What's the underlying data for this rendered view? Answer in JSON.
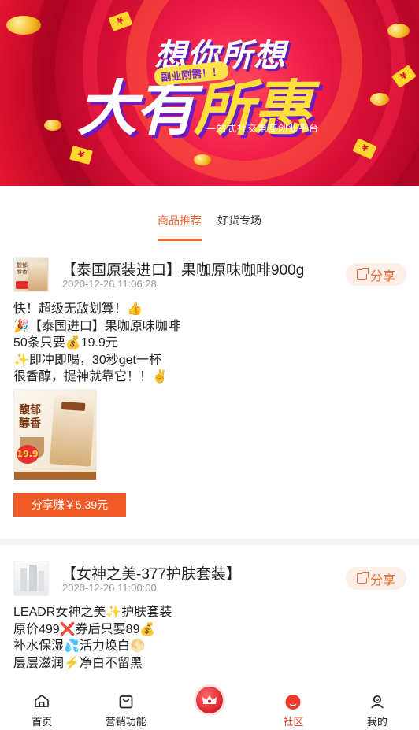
{
  "banner": {
    "line1": "想你所想",
    "tag": "副业刚需！！",
    "line2_a": "大有",
    "line2_b": "所惠",
    "subtitle": "—站式社交电商创业平台",
    "envelope_char": "¥"
  },
  "tabs": [
    {
      "label": "商品推荐",
      "active": true
    },
    {
      "label": "好货专场",
      "active": false
    }
  ],
  "posts": [
    {
      "title": "【泰国原装进口】果咖原味咖啡900g",
      "time": "2020-12-26 11:06:28",
      "share_label": "分享",
      "lines": [
        "快！超级无敌划算！👍",
        "🎉【泰国进口】果咖原味咖啡",
        "50条只要💰19.9元",
        "✨即冲即喝，30秒get一杯",
        "很香醇，提神就靠它！！✌"
      ],
      "product_image": {
        "text": "馥郁醇香",
        "price": "19.9"
      },
      "earn_label": "分享赚￥5.39元"
    },
    {
      "title": "【女神之美-377护肤套装】",
      "time": "2020-12-26 11:00:00",
      "share_label": "分享",
      "lines": [
        "LEADR女神之美✨护肤套装",
        "原价499❌券后只要89💰",
        "补水保湿💦活力焕白🌕",
        "层层滋润⚡净白不留黑"
      ]
    }
  ],
  "nav": [
    {
      "label": "首页",
      "icon": "home-icon"
    },
    {
      "label": "营销功能",
      "icon": "bag-icon"
    },
    {
      "label": "",
      "icon": "crown-icon"
    },
    {
      "label": "社区",
      "icon": "community-icon",
      "active": true
    },
    {
      "label": "我的",
      "icon": "user-icon"
    }
  ],
  "colors": {
    "accent": "#ec6b2e",
    "earn_button": "#ef5a26",
    "nav_active": "#e9422b",
    "banner_red": "#e6142f"
  }
}
